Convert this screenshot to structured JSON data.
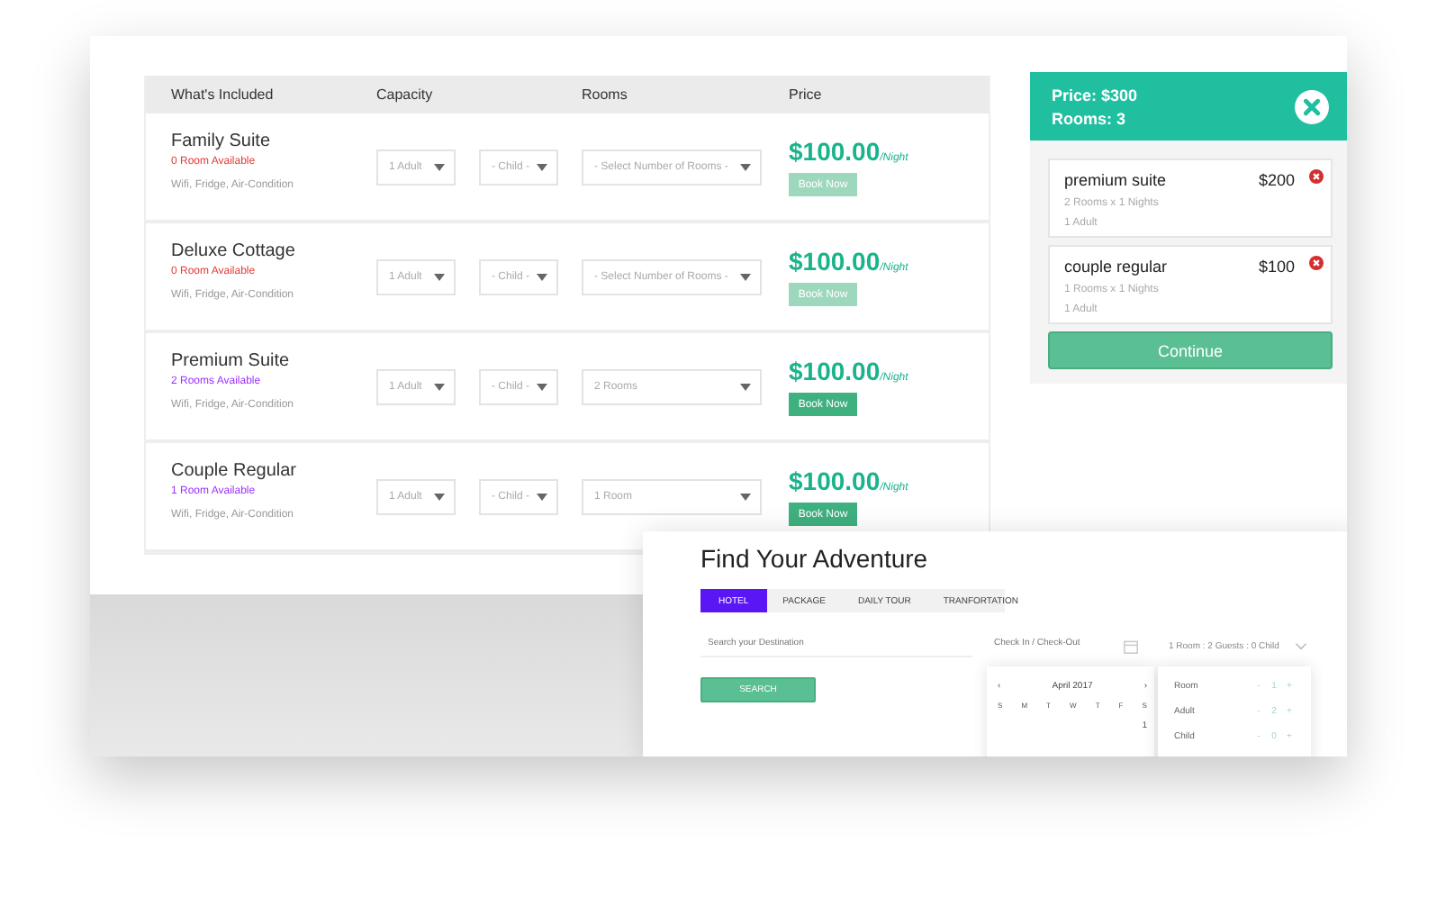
{
  "table": {
    "columns": [
      "What's Included",
      "Capacity",
      "Rooms",
      "Price"
    ],
    "rows": [
      {
        "name": "Family Suite",
        "availability": "0 Room Available",
        "color": "#e53935",
        "amenities": "Wifi, Fridge, Air-Condition",
        "adults": "1 Adult",
        "children": "- Child -",
        "rooms": "- Select Number of Rooms -",
        "price": "$100.00",
        "unit": "/Night",
        "button": "Book Now",
        "disabled": true
      },
      {
        "name": "Deluxe Cottage",
        "availability": "0 Room Available",
        "color": "#e53935",
        "amenities": "Wifi, Fridge, Air-Condition",
        "adults": "1 Adult",
        "children": "- Child -",
        "rooms": "- Select Number of Rooms -",
        "price": "$100.00",
        "unit": "/Night",
        "button": "Book Now",
        "disabled": true
      },
      {
        "name": "Premium Suite",
        "availability": "2 Rooms Available",
        "color": "#9b30ff",
        "amenities": "Wifi, Fridge, Air-Condition",
        "adults": "1 Adult",
        "children": "- Child -",
        "rooms": "2 Rooms",
        "price": "$100.00",
        "unit": "/Night",
        "button": "Book Now",
        "disabled": false
      },
      {
        "name": "Couple Regular",
        "availability": "1 Room Available",
        "color": "#9b30ff",
        "amenities": "Wifi, Fridge, Air-Condition",
        "adults": "1 Adult",
        "children": "- Child -",
        "rooms": "1 Room",
        "price": "$100.00",
        "unit": "/Night",
        "button": "Book Now",
        "disabled": false
      }
    ]
  },
  "cart": {
    "price": "Price: $300",
    "rooms": "Rooms: 3",
    "items": [
      {
        "name": "premium suite",
        "price": "$200",
        "detail": "2 Rooms x 1 Nights",
        "guests": "1 Adult"
      },
      {
        "name": "couple regular",
        "price": "$100",
        "detail": "1 Rooms x 1 Nights",
        "guests": "1 Adult"
      }
    ],
    "button": "Continue"
  },
  "search_card": {
    "title": "Find Your Adventure",
    "tabs": [
      {
        "label": "HOTEL",
        "selected": true
      },
      {
        "label": "PACKAGE",
        "selected": false
      },
      {
        "label": "DAILY TOUR",
        "selected": false
      },
      {
        "label": "TRANFORTATION",
        "selected": false
      }
    ],
    "destination": {
      "placeholder": "Search your Destination"
    },
    "dates": {
      "placeholder": "Check In / Check-Out"
    },
    "guests": "1 Room : 2 Guests : 0 Child",
    "button": "SEARCH",
    "calendar": {
      "prev": "‹",
      "month": "April 2017",
      "next": "›",
      "weekdays": [
        "S",
        "M",
        "T",
        "W",
        "T",
        "F",
        "S"
      ],
      "days": [
        "1"
      ]
    },
    "guest_picker": [
      {
        "label": "Room",
        "minus": "-",
        "value": "1",
        "plus": "+"
      },
      {
        "label": "Adult",
        "minus": "-",
        "value": "2",
        "plus": "+"
      },
      {
        "label": "Child",
        "minus": "-",
        "value": "0",
        "plus": "+"
      }
    ]
  }
}
